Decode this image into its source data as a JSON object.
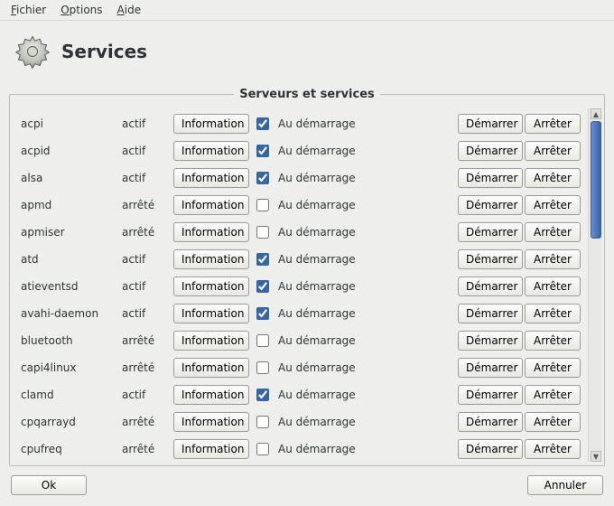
{
  "menu": {
    "file": "Fichier",
    "options": "Options",
    "help": "Aide"
  },
  "header": {
    "title": "Services"
  },
  "frame": {
    "title": "Serveurs et services"
  },
  "labels": {
    "info_button": "Information",
    "boot_checkbox": "Au démarrage",
    "start_button": "Démarrer",
    "stop_button": "Arrêter",
    "status_active": "actif",
    "status_stopped": "arrêté"
  },
  "services": [
    {
      "name": "acpi",
      "status": "actif",
      "boot": true
    },
    {
      "name": "acpid",
      "status": "actif",
      "boot": true
    },
    {
      "name": "alsa",
      "status": "actif",
      "boot": true
    },
    {
      "name": "apmd",
      "status": "arrêté",
      "boot": false
    },
    {
      "name": "apmiser",
      "status": "arrêté",
      "boot": false
    },
    {
      "name": "atd",
      "status": "actif",
      "boot": true
    },
    {
      "name": "atieventsd",
      "status": "actif",
      "boot": true
    },
    {
      "name": "avahi-daemon",
      "status": "actif",
      "boot": true
    },
    {
      "name": "bluetooth",
      "status": "arrêté",
      "boot": false
    },
    {
      "name": "capi4linux",
      "status": "arrêté",
      "boot": false
    },
    {
      "name": "clamd",
      "status": "actif",
      "boot": true
    },
    {
      "name": "cpqarrayd",
      "status": "arrêté",
      "boot": false
    },
    {
      "name": "cpufreq",
      "status": "arrêté",
      "boot": false
    }
  ],
  "footer": {
    "ok": "Ok",
    "cancel": "Annuler"
  }
}
